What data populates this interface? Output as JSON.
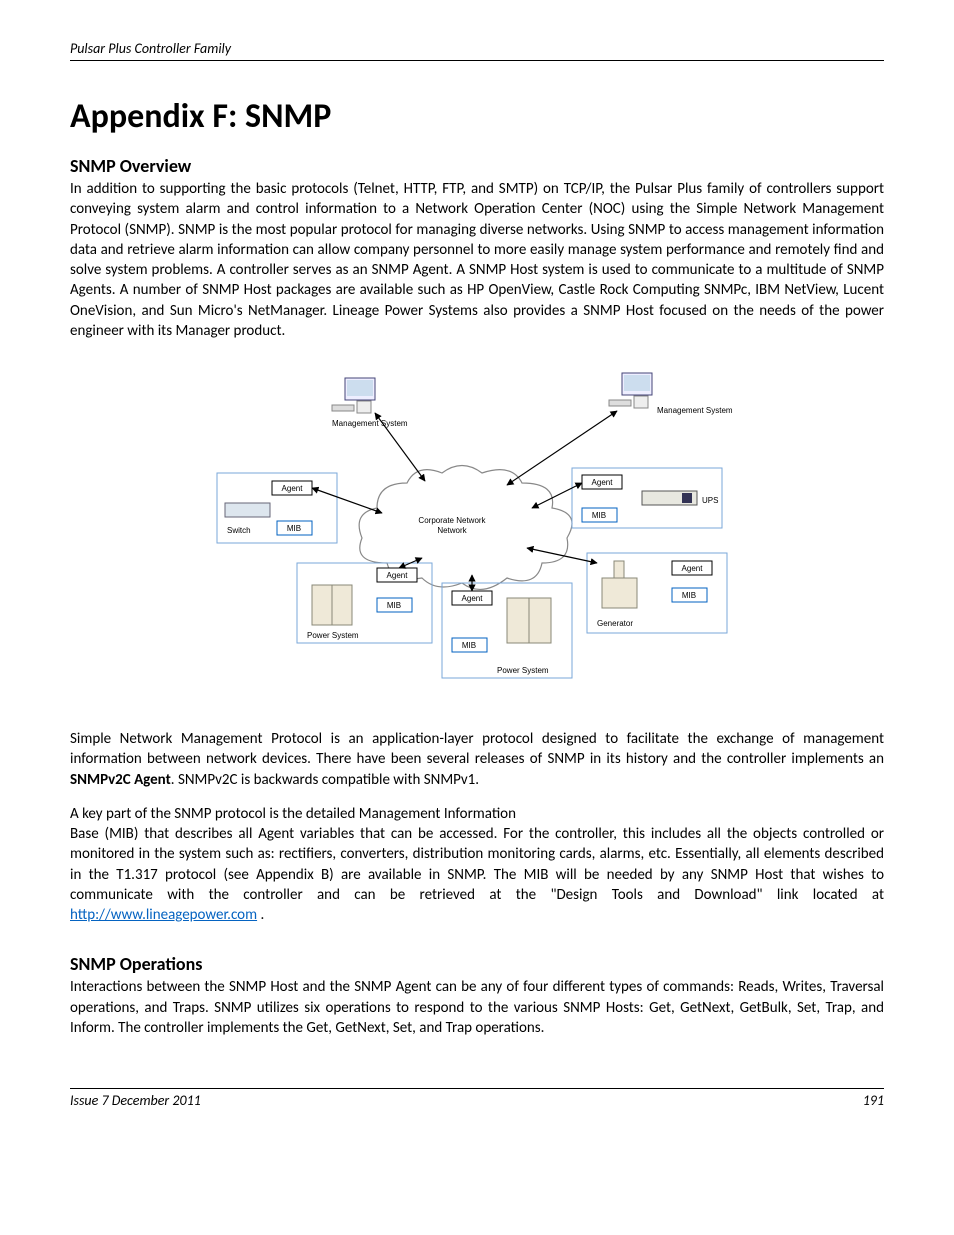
{
  "header": {
    "running": "Pulsar Plus Controller Family"
  },
  "title": "Appendix F: SNMP",
  "sections": {
    "overview": {
      "heading": "SNMP Overview",
      "p1": "In addition to supporting the basic protocols (Telnet, HTTP, FTP, and SMTP) on TCP/IP, the Pulsar Plus family of controllers support conveying system alarm and control information to a Network Operation Center (NOC) using the Simple Network Management Protocol (SNMP). SNMP is the most popular protocol for managing diverse networks. Using SNMP to access management information data and retrieve alarm information can allow company personnel to more easily manage system performance and remotely find and solve system problems. A controller serves as an SNMP Agent.  A SNMP Host system is used to communicate to a multitude of SNMP Agents.  A number of SNMP Host packages are available such as HP OpenView, Castle Rock Computing SNMPc, IBM NetView, Lucent OneVision, and Sun Micro's NetManager. Lineage Power Systems also provides a SNMP Host focused on the needs of the power engineer with its Manager product.",
      "p2a": "Simple Network Management Protocol is an application-layer protocol designed to facilitate the exchange of management information between network devices. There have been several releases of SNMP in its history and the controller implements an ",
      "p2bold": "SNMPv2C Agent",
      "p2b": ". SNMPv2C is backwards compatible with SNMPv1.",
      "p3": "A key part of the SNMP protocol is the detailed Management Information",
      "p4a": "Base (MIB) that describes all Agent variables that can be accessed.  For the controller, this includes all the objects controlled or monitored in the system such as: rectifiers, converters, distribution monitoring cards, alarms, etc. Essentially, all elements described in the T1.317 protocol (see Appendix B) are available in SNMP.  The MIB will be needed by any SNMP Host that wishes to communicate with the controller and can be retrieved at the \"Design Tools and Download\" link located at ",
      "link": "http://www.lineagepower.com",
      "p4b": " ."
    },
    "operations": {
      "heading": "SNMP Operations",
      "p1": "Interactions between the SNMP Host and the SNMP Agent  can be any of four different types of commands: Reads, Writes, Traversal operations, and Traps. SNMP utilizes six operations to respond to the various SNMP Hosts: Get, GetNext, GetBulk, Set, Trap, and Inform. The controller implements the Get, GetNext, Set, and Trap operations."
    }
  },
  "diagram": {
    "cloud": "Corporate\nNetwork",
    "labels": {
      "mgmt": "Management System",
      "agent": "Agent",
      "mib": "MIB",
      "switch": "Switch",
      "ups": "UPS",
      "power": "Power System",
      "generator": "Generator"
    }
  },
  "footer": {
    "issue": "Issue 7 December 2011",
    "page": "191"
  }
}
